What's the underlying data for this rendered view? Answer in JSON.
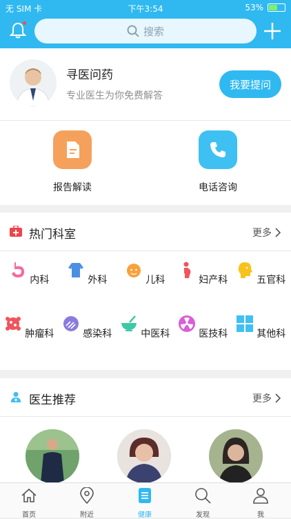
{
  "status_bar": {
    "carrier": "无 SIM 卡",
    "time": "下午3:54",
    "battery": "53%",
    "battery_level": 0.53
  },
  "header": {
    "search_placeholder": "搜索"
  },
  "intro": {
    "title": "寻医问药",
    "subtitle": "专业医生为你免费解答",
    "ask_button": "我要提问"
  },
  "quick_actions": [
    {
      "label": "报告解读",
      "icon": "report-icon",
      "color": "#f6a15b"
    },
    {
      "label": "电话咨询",
      "icon": "phone-icon",
      "color": "#3fc0f2"
    }
  ],
  "departments": {
    "title": "热门科室",
    "more": "更多",
    "items": [
      {
        "label": "内科",
        "icon": "stomach-icon"
      },
      {
        "label": "外科",
        "icon": "body-icon"
      },
      {
        "label": "儿科",
        "icon": "baby-icon"
      },
      {
        "label": "妇产科",
        "icon": "pregnant-icon"
      },
      {
        "label": "五官科",
        "icon": "head-icon"
      },
      {
        "label": "肿瘤科",
        "icon": "tumor-icon"
      },
      {
        "label": "感染科",
        "icon": "virus-icon"
      },
      {
        "label": "中医科",
        "icon": "mortar-icon"
      },
      {
        "label": "医技科",
        "icon": "radiation-icon"
      },
      {
        "label": "其他科",
        "icon": "grid-icon"
      }
    ]
  },
  "doctors": {
    "title": "医生推荐",
    "more": "更多"
  },
  "tabbar": [
    {
      "label": "首页",
      "icon": "home-icon"
    },
    {
      "label": "附近",
      "icon": "location-icon"
    },
    {
      "label": "健康",
      "icon": "health-icon",
      "active": true
    },
    {
      "label": "发现",
      "icon": "search-icon"
    },
    {
      "label": "我",
      "icon": "user-icon"
    }
  ],
  "colors": {
    "brand": "#2fb9f0"
  }
}
